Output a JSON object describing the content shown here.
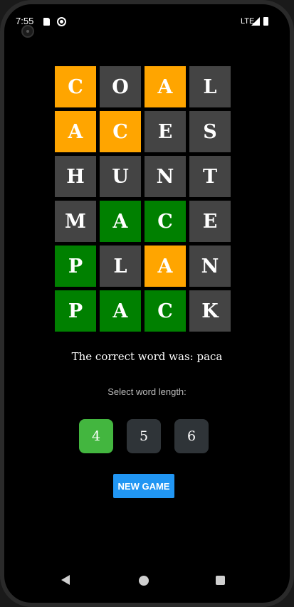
{
  "status_bar": {
    "time": "7:55",
    "network": "LTE"
  },
  "icons": {
    "sd_card": "sd-card-icon",
    "sync": "sync-icon",
    "signal": "signal-icon",
    "battery": "battery-icon"
  },
  "board": {
    "rows": [
      [
        {
          "letter": "C",
          "state": "orange"
        },
        {
          "letter": "O",
          "state": "gray"
        },
        {
          "letter": "A",
          "state": "orange"
        },
        {
          "letter": "L",
          "state": "gray"
        }
      ],
      [
        {
          "letter": "A",
          "state": "orange"
        },
        {
          "letter": "C",
          "state": "orange"
        },
        {
          "letter": "E",
          "state": "gray"
        },
        {
          "letter": "S",
          "state": "gray"
        }
      ],
      [
        {
          "letter": "H",
          "state": "gray"
        },
        {
          "letter": "U",
          "state": "gray"
        },
        {
          "letter": "N",
          "state": "gray"
        },
        {
          "letter": "T",
          "state": "gray"
        }
      ],
      [
        {
          "letter": "M",
          "state": "gray"
        },
        {
          "letter": "A",
          "state": "green"
        },
        {
          "letter": "C",
          "state": "green"
        },
        {
          "letter": "E",
          "state": "gray"
        }
      ],
      [
        {
          "letter": "P",
          "state": "green"
        },
        {
          "letter": "L",
          "state": "gray"
        },
        {
          "letter": "A",
          "state": "orange"
        },
        {
          "letter": "N",
          "state": "gray"
        }
      ],
      [
        {
          "letter": "P",
          "state": "green"
        },
        {
          "letter": "A",
          "state": "green"
        },
        {
          "letter": "C",
          "state": "green"
        },
        {
          "letter": "K",
          "state": "gray"
        }
      ]
    ]
  },
  "colors": {
    "orange": "#ffa500",
    "green": "#008000",
    "gray": "#444444",
    "selected_length": "#43b63f",
    "button_blue": "#2196f3"
  },
  "result": {
    "correct_word_text": "The correct word was: paca"
  },
  "word_length": {
    "prompt": "Select word length:",
    "options": [
      "4",
      "5",
      "6"
    ],
    "selected": "4"
  },
  "new_game_label": "NEW GAME"
}
